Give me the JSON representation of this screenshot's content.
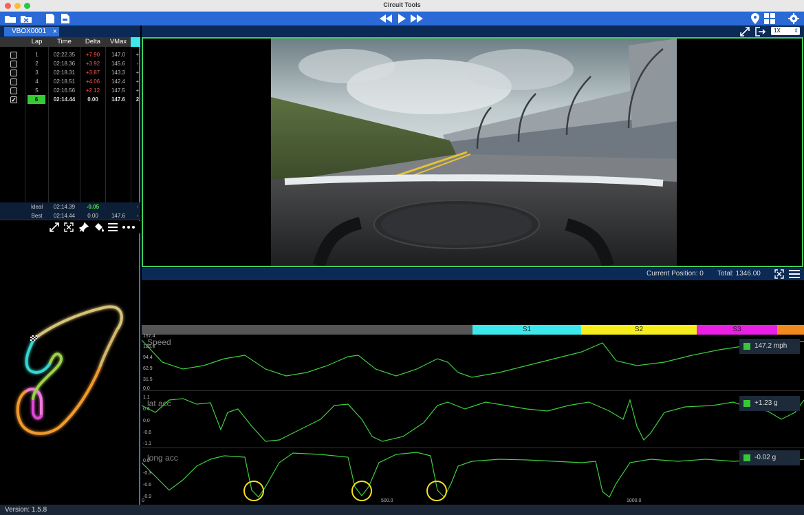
{
  "window": {
    "title": "Circuit Tools"
  },
  "file_tab": {
    "label": "VBOX0001"
  },
  "lap_table": {
    "headers": [
      "Lap",
      "Time",
      "Delta",
      "VMax"
    ],
    "rows": [
      {
        "lap": "1",
        "time": "02:22.35",
        "delta": "+7.90",
        "vmax": "147.0",
        "extra": "+",
        "checked": false
      },
      {
        "lap": "2",
        "time": "02:18.36",
        "delta": "+3.92",
        "vmax": "145.6",
        "extra": "-",
        "checked": false
      },
      {
        "lap": "3",
        "time": "02:18.31",
        "delta": "+3.87",
        "vmax": "143.3",
        "extra": "+",
        "checked": false
      },
      {
        "lap": "4",
        "time": "02:18.51",
        "delta": "+4.06",
        "vmax": "142.4",
        "extra": "+",
        "checked": false
      },
      {
        "lap": "5",
        "time": "02:16.56",
        "delta": "+2.12",
        "vmax": "147.5",
        "extra": "+",
        "checked": false
      },
      {
        "lap": "6",
        "time": "02:14.44",
        "delta": "0.00",
        "vmax": "147.6",
        "extra": "2",
        "checked": true
      }
    ],
    "ideal": {
      "label": "Ideal",
      "time": "02:14.39",
      "delta": "-0.05",
      "extra": "-"
    },
    "best": {
      "label": "Best",
      "time": "02:14.44",
      "delta": "0.00",
      "vmax": "147.6",
      "extra": "-"
    }
  },
  "playback": {
    "speed": "1X"
  },
  "position": {
    "current_label": "Current Position: 0",
    "total_label": "Total: 1346.00"
  },
  "sectors": [
    {
      "label": "S1",
      "color": "#3ce8ec"
    },
    {
      "label": "S2",
      "color": "#f5ee1c"
    },
    {
      "label": "S3",
      "color": "#e91fe4"
    }
  ],
  "graphs": [
    {
      "label": "Speed",
      "ticks": [
        "157.4",
        "126.0",
        "94.4",
        "62.9",
        "31.5",
        "0.0"
      ],
      "readout": "147.2 mph"
    },
    {
      "label": "lat acc",
      "ticks": [
        "1.1",
        "0.6",
        "0.0",
        "-0.6",
        "-1.1"
      ],
      "readout": "+1.23 g"
    },
    {
      "label": "long acc",
      "ticks": [
        "0.0",
        "-0.3",
        "-0.6",
        "-0.9"
      ],
      "readout": "-0.02 g"
    }
  ],
  "distance_axis": {
    "ticks": [
      "0",
      "500.0",
      "1000.0"
    ]
  },
  "status": {
    "version": "Version: 1.5.8"
  },
  "colors": {
    "accent": "#2b6ad6",
    "trace": "#3ecf3e",
    "highlight": "#f5e21c"
  }
}
